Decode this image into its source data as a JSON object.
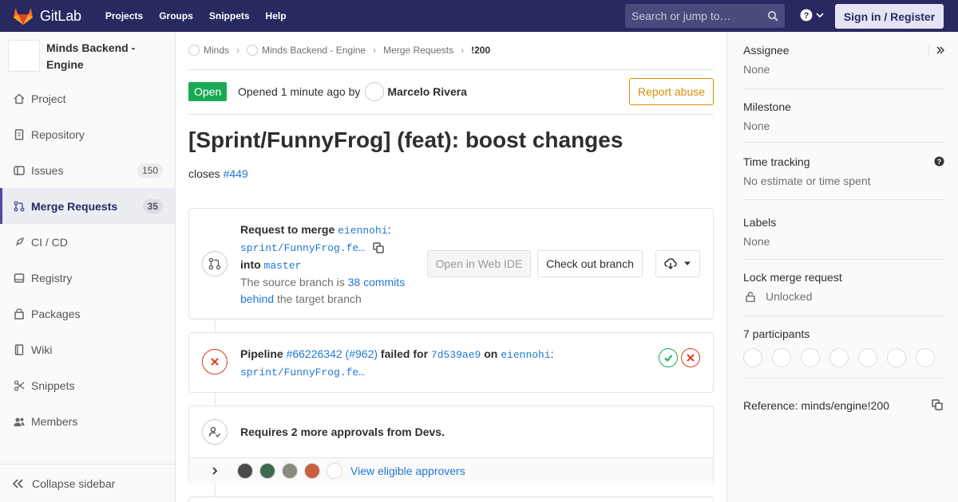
{
  "navbar": {
    "brand": "GitLab",
    "links": [
      "Projects",
      "Groups",
      "Snippets",
      "Help"
    ],
    "search_placeholder": "Search or jump to…",
    "signin_label": "Sign in / Register",
    "bg_color": "#292961"
  },
  "sidebar": {
    "project_name": "Minds Backend - Engine",
    "items": [
      {
        "label": "Project",
        "icon": "home-icon"
      },
      {
        "label": "Repository",
        "icon": "doc-icon"
      },
      {
        "label": "Issues",
        "icon": "issues-icon",
        "count": "150"
      },
      {
        "label": "Merge Requests",
        "icon": "git-merge-icon",
        "count": "35",
        "active": true
      },
      {
        "label": "CI / CD",
        "icon": "rocket-icon"
      },
      {
        "label": "Registry",
        "icon": "disk-icon"
      },
      {
        "label": "Packages",
        "icon": "package-icon"
      },
      {
        "label": "Wiki",
        "icon": "book-icon"
      },
      {
        "label": "Snippets",
        "icon": "scissors-icon"
      },
      {
        "label": "Members",
        "icon": "users-icon"
      }
    ],
    "collapse_label": "Collapse sidebar"
  },
  "breadcrumb": {
    "items": [
      "Minds",
      "Minds Backend - Engine",
      "Merge Requests"
    ],
    "current": "!200"
  },
  "mr": {
    "status": "Open",
    "opened_prefix": "Opened",
    "opened_time": "1 minute ago",
    "opened_by": "by",
    "author": "Marcelo Rivera",
    "report_label": "Report abuse",
    "title": "[Sprint/FunnyFrog] (feat): boost changes",
    "desc_prefix": "closes",
    "desc_issue": "#449"
  },
  "merge_widget": {
    "request_label": "Request to merge",
    "source_user": "eiennohi",
    "source_branch": "sprint/FunnyFrog.fe…",
    "into_label": "into",
    "target_branch": "master",
    "behind_prefix": "The source branch is",
    "behind_link": "38 commits behind",
    "behind_suffix": "the target branch",
    "webide_label": "Open in Web IDE",
    "checkout_label": "Check out branch"
  },
  "pipeline": {
    "label": "Pipeline",
    "id": "#66226342",
    "iid": "(#962)",
    "status_text": "failed for",
    "commit": "7d539ae9",
    "on_label": "on",
    "user": "eiennohi",
    "branch": "sprint/FunnyFrog.fe…",
    "stages": [
      {
        "status": "success",
        "icon": "check-icon",
        "color": "#1aaa55"
      },
      {
        "status": "failed",
        "icon": "close-icon",
        "color": "#db3b21"
      }
    ]
  },
  "approvals": {
    "text": "Requires 2 more approvals from Devs.",
    "view_label": "View eligible approvers",
    "approver_count_shown": 5
  },
  "right_sidebar": {
    "assignee_label": "Assignee",
    "assignee_value": "None",
    "milestone_label": "Milestone",
    "milestone_value": "None",
    "time_label": "Time tracking",
    "time_value": "No estimate or time spent",
    "labels_label": "Labels",
    "labels_value": "None",
    "lock_label": "Lock merge request",
    "lock_value": "Unlocked",
    "participants_label": "7 participants",
    "participant_count": 7,
    "reference_label": "Reference: minds/engine!200"
  }
}
